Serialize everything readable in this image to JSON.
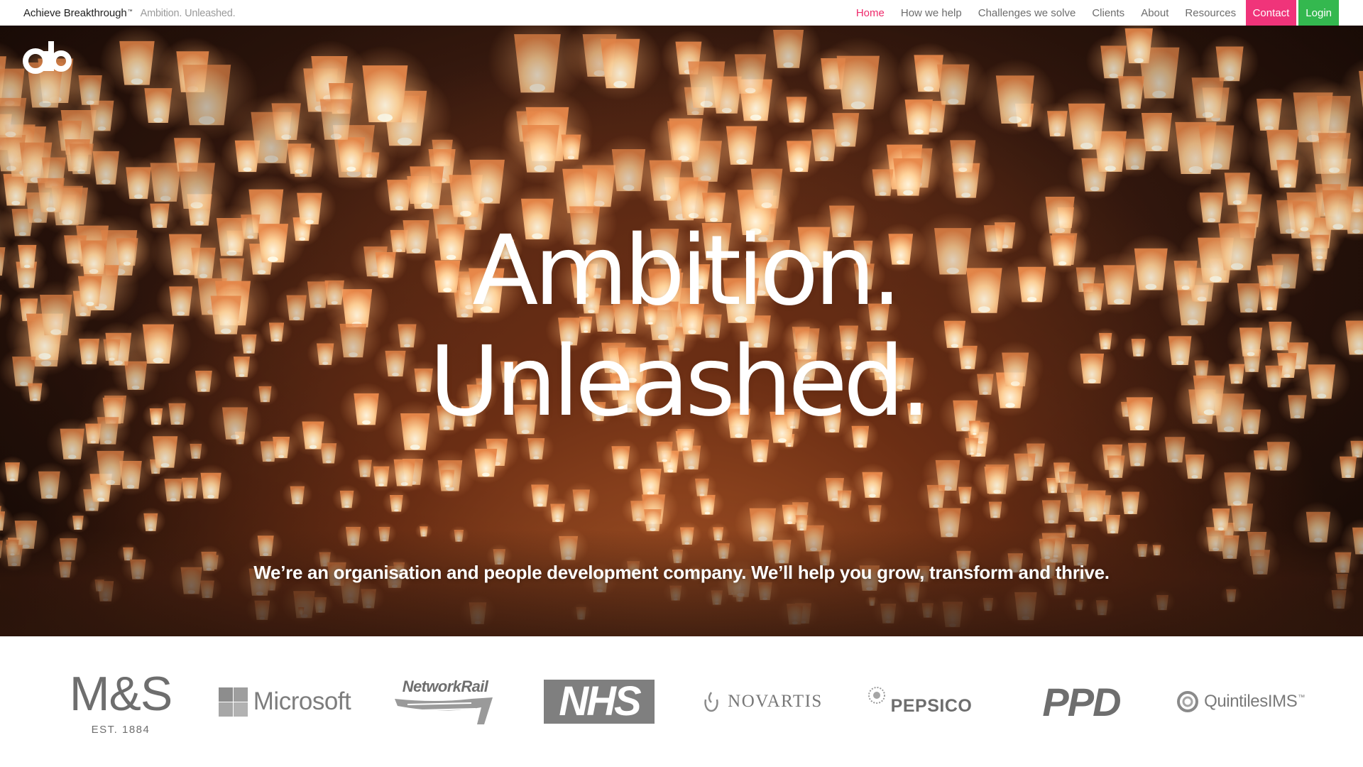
{
  "header": {
    "brand_name": "Achieve Breakthrough",
    "brand_tm": "™",
    "tagline": "Ambition. Unleashed."
  },
  "nav": {
    "items": [
      {
        "label": "Home",
        "active": true
      },
      {
        "label": "How we help"
      },
      {
        "label": "Challenges we solve"
      },
      {
        "label": "Clients"
      },
      {
        "label": "About"
      },
      {
        "label": "Resources"
      }
    ],
    "contact_label": "Contact",
    "login_label": "Login"
  },
  "hero": {
    "logo_text": "ab",
    "headline_line1": "Ambition.",
    "headline_line2": "Unleashed.",
    "subline": "We’re an organisation and people development company. We’ll help you grow, transform and thrive."
  },
  "clients": {
    "ms_name": "M&S",
    "ms_est": "EST. 1884",
    "microsoft": "Microsoft",
    "networkrail": "NetworkRail",
    "nhs": "NHS",
    "novartis": "NOVARTIS",
    "pepsico": "PEPSICO",
    "ppd": "PPD",
    "quintiles": "QuintilesIMS",
    "quintiles_tm": "™"
  },
  "colors": {
    "nav_active": "#ee2a6b",
    "contact_bg": "#f0347a",
    "login_bg": "#34b84f",
    "nav_text": "#6d6d6d",
    "tagline_text": "#9a9a9a"
  }
}
